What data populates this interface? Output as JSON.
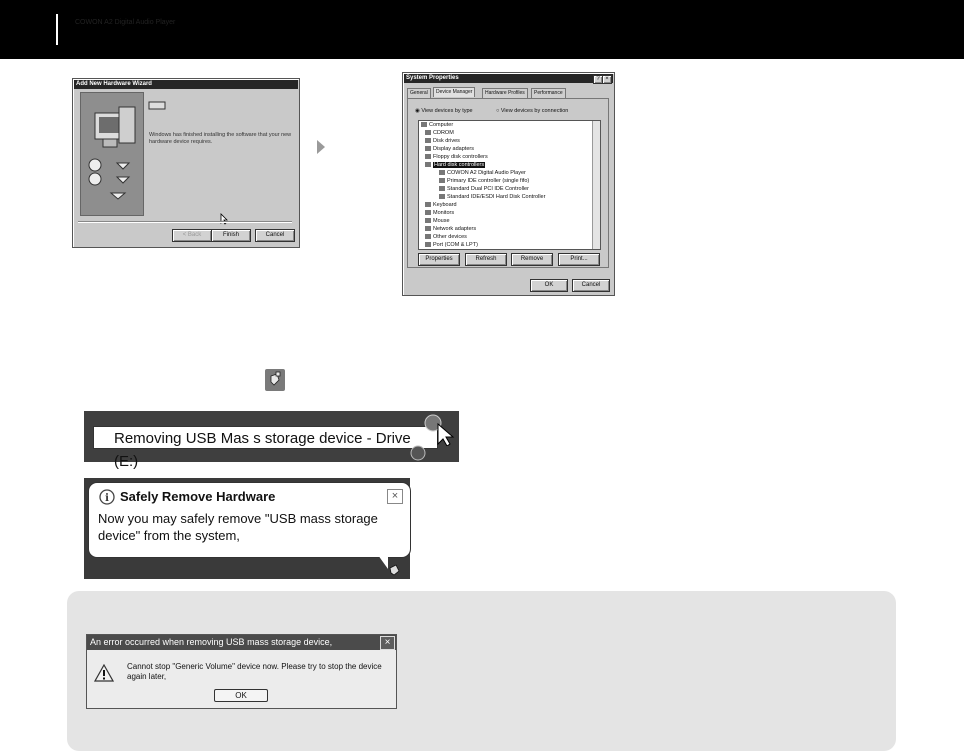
{
  "wizard": {
    "title": "Add New Hardware Wizard",
    "device_name": "COWON A2 Digital Audio Player",
    "message": "Windows has finished installing the software that your new hardware device requires.",
    "back_label": "< Back",
    "finish_label": "Finish",
    "cancel_label": "Cancel"
  },
  "system_properties": {
    "title": "System Properties",
    "title_buttons": [
      "?",
      "×"
    ],
    "tabs": [
      "General",
      "Device Manager",
      "Hardware Profiles",
      "Performance"
    ],
    "view_by_type": "View devices by type",
    "view_by_connection": "View devices by connection",
    "tree": [
      "Computer",
      "CDROM",
      "Disk drives",
      "Display adapters",
      "Floppy disk controllers",
      "Hard disk controllers",
      "COWON A2 Digital Audio Player",
      "Primary IDE controller (single fifo)",
      "Standard Dual PCI IDE Controller",
      "Standard IDE/ESDI Hard Disk Controller",
      "Keyboard",
      "Monitors",
      "Mouse",
      "Network adapters",
      "Other devices",
      "Port (COM & LPT)"
    ],
    "buttons": [
      "Properties",
      "Refresh",
      "Remove",
      "Print..."
    ],
    "ok_label": "OK",
    "cancel_label": "Cancel"
  },
  "removing": {
    "text": "Removing USB Mas s storage device - Drive (E:)"
  },
  "balloon": {
    "title": "Safely Remove Hardware",
    "message_line1": "Now you may safely remove \"USB mass storage",
    "message_line2": "device\" from the system,",
    "close_glyph": "×"
  },
  "error_dialog": {
    "title": "An error occurred when removing USB mass storage device,",
    "message_line1": "Cannot stop \"Generic Volume\" device now. Please try to stop the device",
    "message_line2": "again later,",
    "ok_label": "OK",
    "close_glyph": "×"
  },
  "icons": [
    "monitor-icon",
    "cd-icon",
    "safely-remove-hardware-icon",
    "warning-icon",
    "info-icon",
    "arrow-right-icon",
    "mouse-cursor-icon"
  ]
}
